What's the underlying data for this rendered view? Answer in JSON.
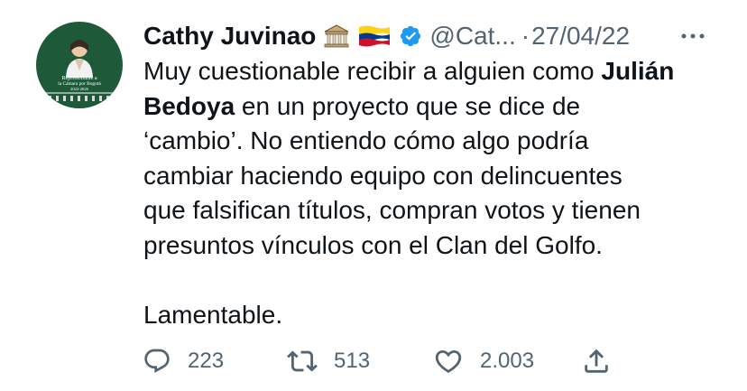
{
  "tweet": {
    "author": {
      "name": "Cathy Juvinao",
      "emoji_1": "classical-building-emoji",
      "emoji_2": "colombia-flag-emoji",
      "verified": "verified-badge-icon",
      "handle": "@Cat...",
      "avatar_text": [
        "Representante a",
        "la Cámara por Bogotá",
        "2022-2026"
      ]
    },
    "separator": "·",
    "date": "27/04/22",
    "more_icon": "more-horizontal-icon",
    "text": {
      "line1_pre": "Muy cuestionable recibir a alguien como ",
      "line1_bold": "Julián",
      "line2_bold": "Bedoya",
      "line2_post": " en un proyecto que se dice de",
      "line3": "‘cambio’. No entiendo cómo algo podría",
      "line4": "cambiar haciendo equipo con delincuentes",
      "line5": "que falsifican títulos, compran votos y tienen",
      "line6": "presuntos vínculos con el Clan del Golfo.",
      "line7": "Lamentable."
    },
    "actions": {
      "reply": {
        "icon": "reply-icon",
        "count": "223"
      },
      "retweet": {
        "icon": "retweet-icon",
        "count": "513"
      },
      "like": {
        "icon": "heart-icon",
        "count": "2.003"
      },
      "share": {
        "icon": "share-icon"
      }
    }
  },
  "colors": {
    "text": "#0f1419",
    "secondary": "#536471",
    "verified": "#1d9bf0",
    "avatar_bg": "#1e5a3a"
  }
}
